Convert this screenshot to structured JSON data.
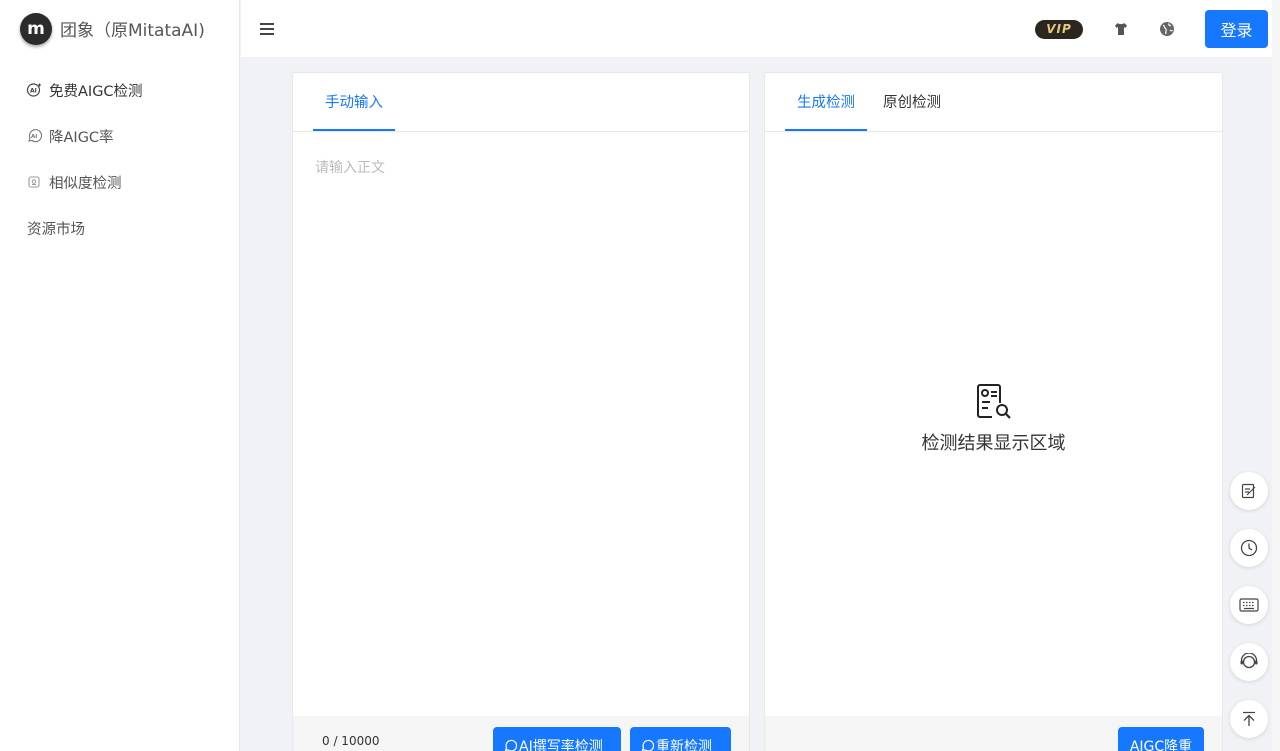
{
  "brand": {
    "logo_text": "m",
    "name": "团象（原MitataAI)"
  },
  "sidebar": {
    "items": [
      {
        "label": "免费AIGC检测",
        "icon": "ai-plus-icon",
        "active": true
      },
      {
        "label": "降AIGC率",
        "icon": "ai-bubble-icon",
        "active": false
      },
      {
        "label": "相似度检测",
        "icon": "similarity-icon",
        "active": false
      },
      {
        "label": "资源市场",
        "icon": "",
        "active": false
      }
    ]
  },
  "header": {
    "vip_label": "VIP",
    "login_label": "登录",
    "icons": [
      "menu-icon",
      "shirt-icon",
      "globe-icon"
    ]
  },
  "left_panel": {
    "tabs": [
      {
        "label": "手动输入",
        "active": true
      }
    ],
    "editor_placeholder": "请输入正文",
    "counter": "0 / 10000",
    "check_button": "AI撰写率检测",
    "recheck_button": "重新检测"
  },
  "right_panel": {
    "tabs": [
      {
        "label": "生成检测",
        "active": true
      },
      {
        "label": "原创检测",
        "active": false
      }
    ],
    "empty_text": "检测结果显示区域",
    "reduce_button": "AIGC降重"
  },
  "float_tools": [
    "edit-icon",
    "clock-icon",
    "keyboard-icon",
    "support-icon",
    "back-to-top-icon"
  ],
  "colors": {
    "accent": "#1677ff",
    "vip_bg": "#2b2620",
    "vip_text": "#e8c77a"
  }
}
